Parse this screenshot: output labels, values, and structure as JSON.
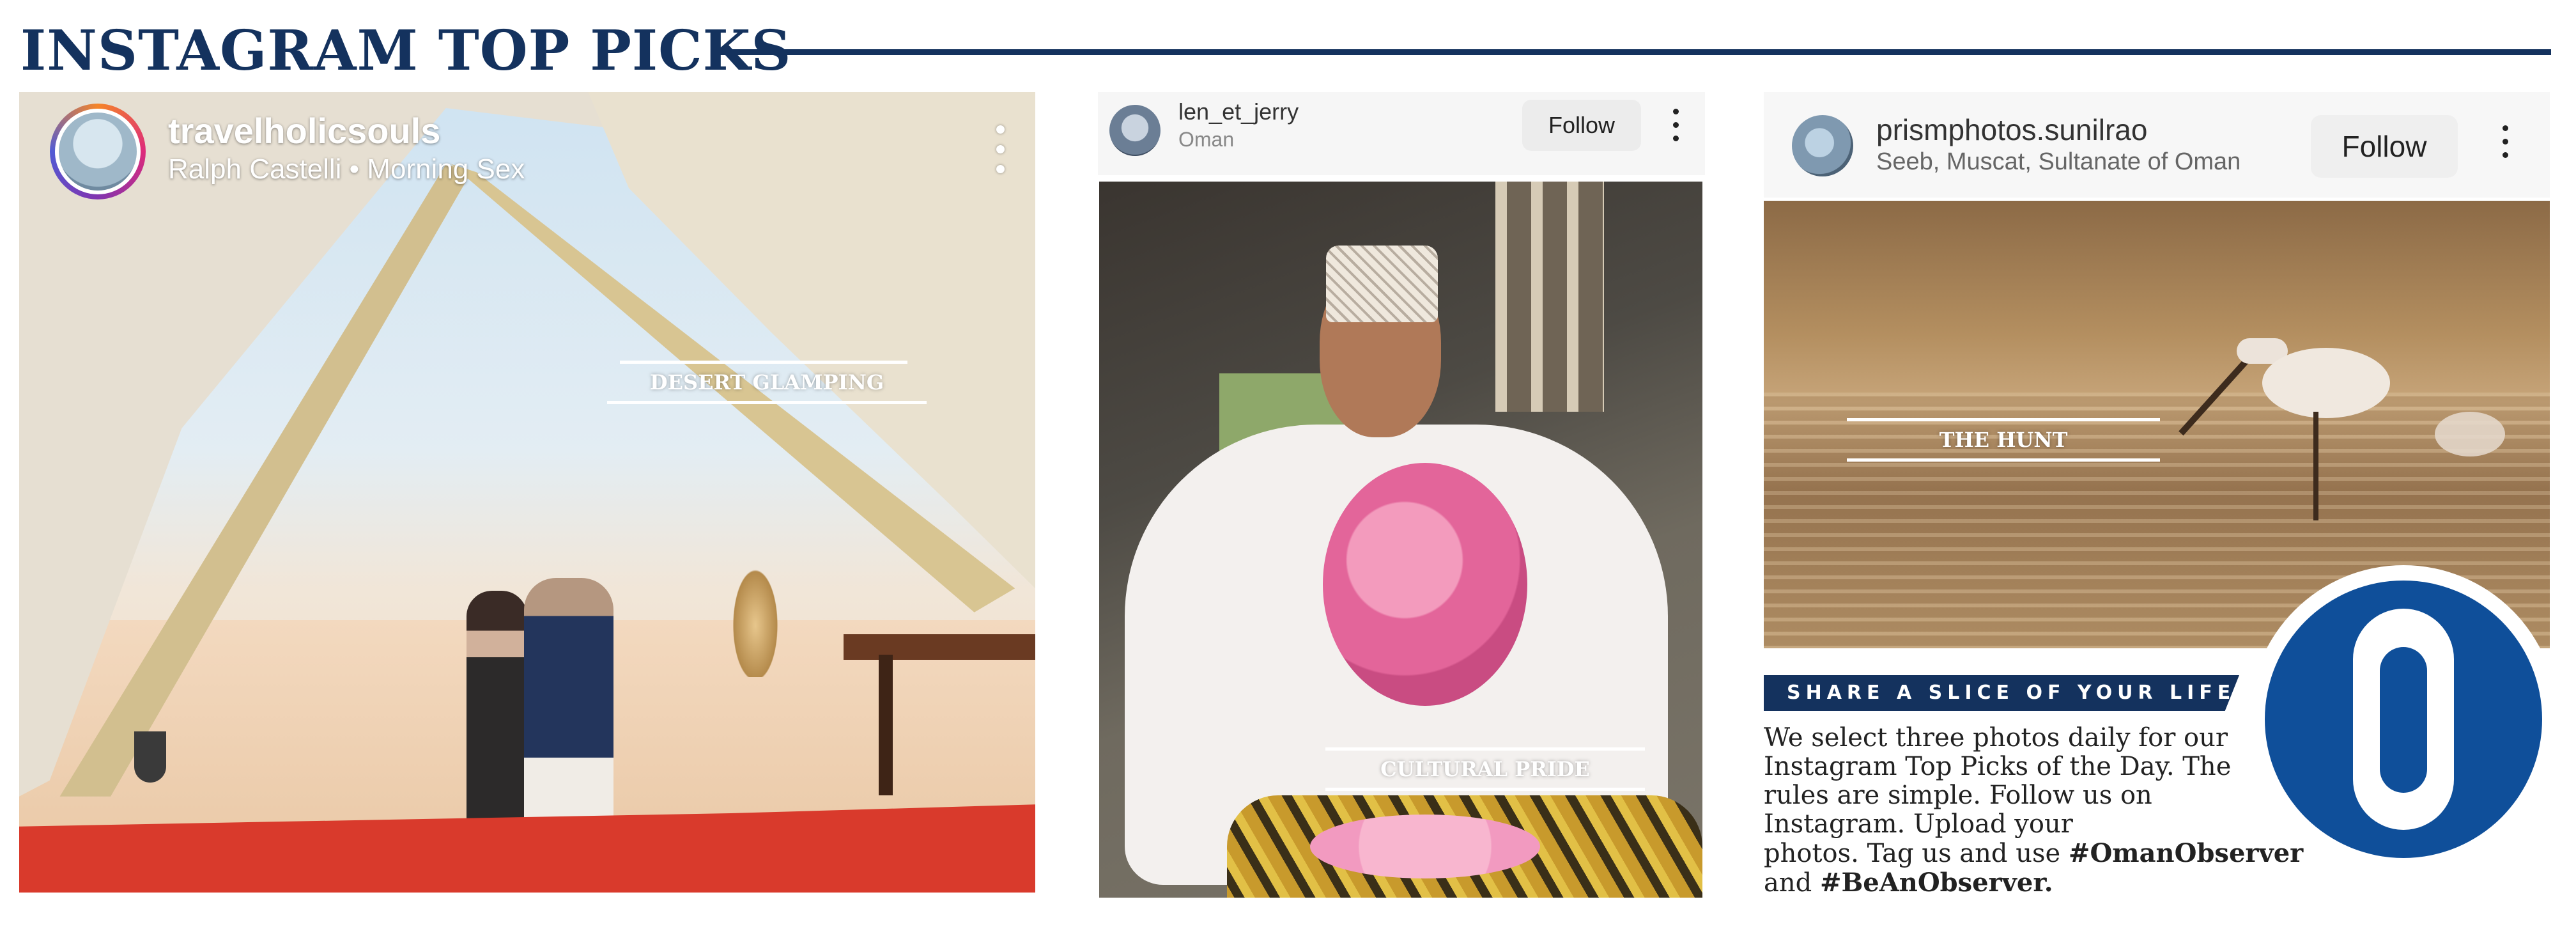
{
  "header": {
    "title": "INSTAGRAM TOP PICKS"
  },
  "posts": [
    {
      "username": "travelholicsouls",
      "subline": "Ralph Castelli • Morning Sex",
      "caption": "DESERT GLAMPING",
      "more_icon": "vertical-ellipsis"
    },
    {
      "username": "len_et_jerry",
      "location": "Oman",
      "follow_label": "Follow",
      "caption": "CULTURAL PRIDE",
      "more_icon": "vertical-ellipsis"
    },
    {
      "username": "prismphotos.sunilrao",
      "location": "Seeb, Muscat, Sultanate of Oman",
      "follow_label": "Follow",
      "caption": "THE HUNT",
      "more_icon": "vertical-ellipsis"
    }
  ],
  "share": {
    "heading": "SHARE A SLICE OF YOUR LIFE",
    "line1": "We select three photos daily for our",
    "line2": "Instagram Top Picks of the Day. The",
    "line3": "rules are simple. Follow us on",
    "line4": "Instagram. Upload your",
    "line5_prefix": "photos. Tag us and use ",
    "hashtag1": "#OmanObserver",
    "line6_prefix": "and ",
    "hashtag2": "#BeAnObserver."
  },
  "logo": {
    "letter": "O",
    "color": "#0f4f9a"
  },
  "colors": {
    "navy": "#14325e",
    "logo_blue": "#0f4f9a"
  }
}
